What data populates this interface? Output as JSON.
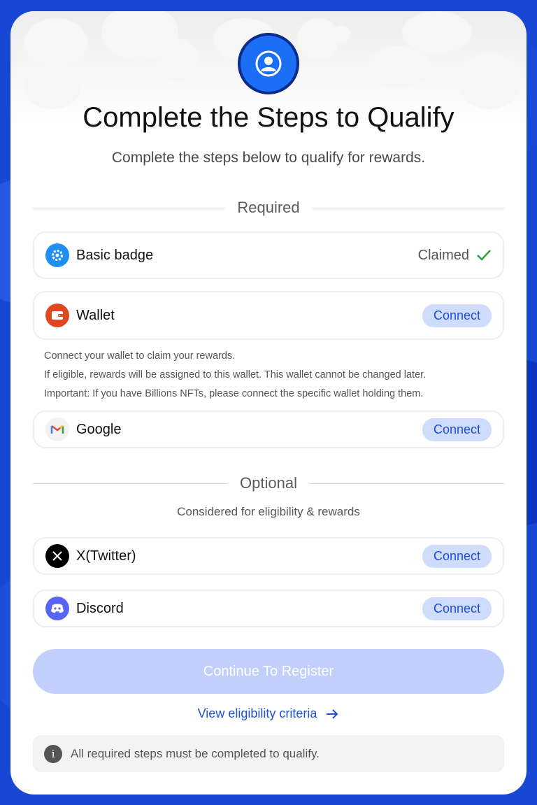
{
  "header": {
    "title": "Complete the Steps to Qualify",
    "subtitle": "Complete the steps below to qualify for rewards."
  },
  "required": {
    "label": "Required",
    "steps": [
      {
        "name": "Basic badge",
        "status": "Claimed",
        "icon": "badge-gear-icon"
      },
      {
        "name": "Wallet",
        "action": "Connect",
        "icon": "wallet-icon"
      },
      {
        "name": "Google",
        "action": "Connect",
        "icon": "gmail-icon"
      }
    ],
    "wallet_notes": [
      "Connect your wallet to claim your rewards.",
      "If eligible, rewards will be assigned to this wallet. This wallet cannot be changed later.",
      "Important: If you have Billions NFTs, please connect the specific wallet holding them."
    ]
  },
  "optional": {
    "label": "Optional",
    "note": "Considered for eligibility & rewards",
    "steps": [
      {
        "name": "X(Twitter)",
        "action": "Connect",
        "icon": "x-logo-icon"
      },
      {
        "name": "Discord",
        "action": "Connect",
        "icon": "discord-icon"
      }
    ]
  },
  "actions": {
    "continue": "Continue To Register",
    "criteria": "View eligibility criteria"
  },
  "info": {
    "text": "All required steps must be completed to qualify."
  },
  "colors": {
    "primary": "#1f4fd6",
    "page_bg": "#1747d4",
    "connect_bg": "#cfdcfb",
    "disabled_button": "#c0d0fb",
    "success": "#2e9e3f"
  }
}
